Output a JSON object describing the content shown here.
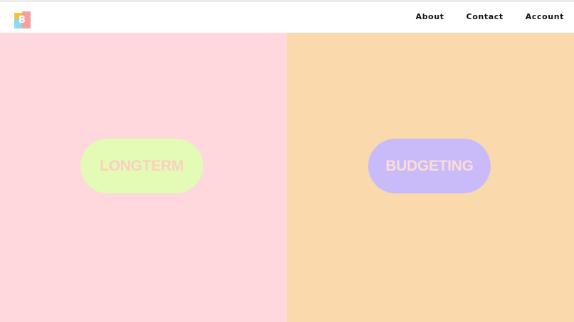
{
  "header": {
    "logo": {
      "letter": "B",
      "icon": "colorful-block-logo-icon"
    },
    "nav": [
      {
        "label": "About"
      },
      {
        "label": "Contact"
      },
      {
        "label": "Account"
      }
    ]
  },
  "panels": [
    {
      "label": "LONGTERM",
      "background": "#fed8dd",
      "pill_color": "#e3fbb4",
      "text_color": "#fccfc4"
    },
    {
      "label": "BUDGETING",
      "background": "#fadaac",
      "pill_color": "#c9bbfa",
      "text_color": "#fcdcd5"
    }
  ],
  "colors": {
    "header_bg": "#ffffff",
    "nav_text": "#111111"
  }
}
